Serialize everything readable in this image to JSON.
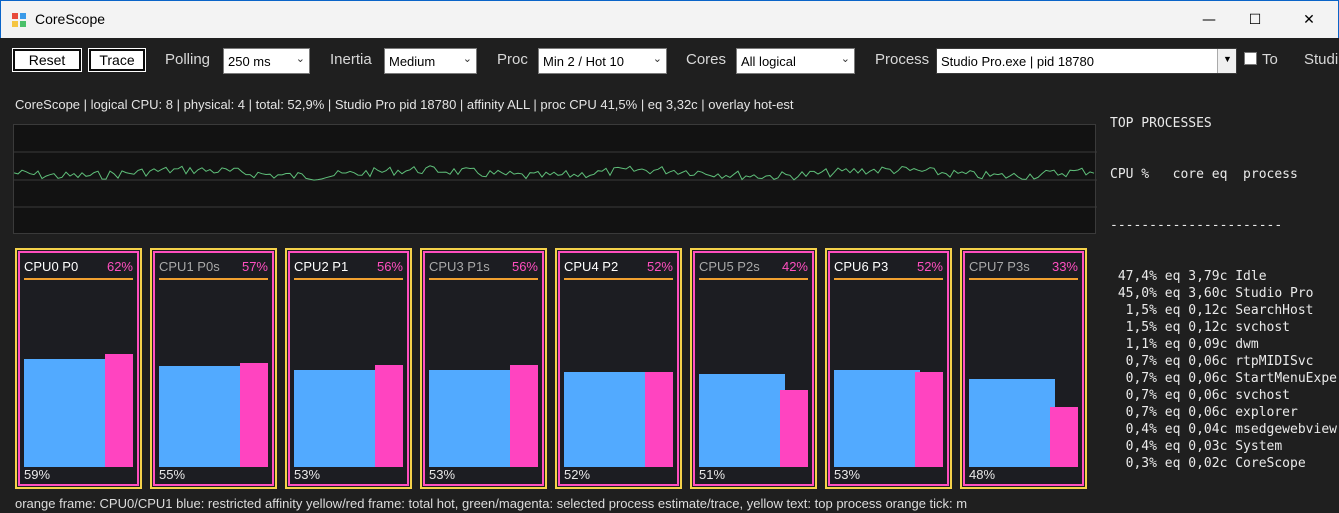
{
  "window": {
    "title": "CoreScope",
    "minimize": "—",
    "maximize": "☐",
    "close": "✕"
  },
  "toolbar": {
    "reset_label": "Reset",
    "trace_label": "Trace",
    "polling_label": "Polling",
    "polling_value": "250 ms",
    "inertia_label": "Inertia",
    "inertia_value": "Medium",
    "proc_label": "Proc",
    "proc_value": "Min 2 / Hot 10",
    "cores_label": "Cores",
    "cores_value": "All logical",
    "process_label": "Process",
    "process_value": "Studio Pro.exe | pid 18780",
    "to_label": "To",
    "studio_label": "Studi"
  },
  "status": "CoreScope  |  logical CPU: 8 | physical: 4  |  total: 52,9%  |  Studio Pro pid 18780 | affinity ALL | proc CPU 41,5% | eq 3,32c | overlay hot-est",
  "tiles": [
    {
      "name": "CPU0 P0",
      "hot_pct": "62%",
      "total_pct": "59%",
      "total": 59,
      "proc": 62,
      "dim": false
    },
    {
      "name": "CPU1 P0s",
      "hot_pct": "57%",
      "total_pct": "55%",
      "total": 55,
      "proc": 57,
      "dim": true
    },
    {
      "name": "CPU2 P1",
      "hot_pct": "56%",
      "total_pct": "53%",
      "total": 53,
      "proc": 56,
      "dim": false
    },
    {
      "name": "CPU3 P1s",
      "hot_pct": "56%",
      "total_pct": "53%",
      "total": 53,
      "proc": 56,
      "dim": true
    },
    {
      "name": "CPU4 P2",
      "hot_pct": "52%",
      "total_pct": "52%",
      "total": 52,
      "proc": 52,
      "dim": false
    },
    {
      "name": "CPU5 P2s",
      "hot_pct": "42%",
      "total_pct": "51%",
      "total": 51,
      "proc": 42,
      "dim": true
    },
    {
      "name": "CPU6 P3",
      "hot_pct": "52%",
      "total_pct": "53%",
      "total": 53,
      "proc": 52,
      "dim": false
    },
    {
      "name": "CPU7 P3s",
      "hot_pct": "33%",
      "total_pct": "48%",
      "total": 48,
      "proc": 33,
      "dim": true
    }
  ],
  "top_processes": {
    "title": "TOP PROCESSES",
    "header": "CPU %   core eq  process",
    "divider": "----------------------",
    "rows": [
      " 47,4% eq 3,79c Idle",
      " 45,0% eq 3,60c Studio Pro",
      "  1,5% eq 0,12c SearchHost",
      "  1,5% eq 0,12c svchost",
      "  1,1% eq 0,09c dwm",
      "  0,7% eq 0,06c rtpMIDISvc",
      "  0,7% eq 0,06c StartMenuExpe",
      "  0,7% eq 0,06c svchost",
      "  0,7% eq 0,06c explorer",
      "  0,4% eq 0,04c msedgewebview",
      "  0,4% eq 0,03c System",
      "  0,3% eq 0,02c CoreScope"
    ]
  },
  "legend": "orange frame: CPU0/CPU1     blue: restricted affinity     yellow/red frame: total hot, green/magenta: selected process estimate/trace, yellow text: top process     orange tick: m",
  "colors": {
    "blue": "#52aaff",
    "pink": "#ff44c0",
    "yellow": "#f5d24a",
    "graph_line": "#5fbf7a"
  },
  "icons": {
    "app": "app-icon",
    "dropdown": "chevron-down-icon"
  }
}
